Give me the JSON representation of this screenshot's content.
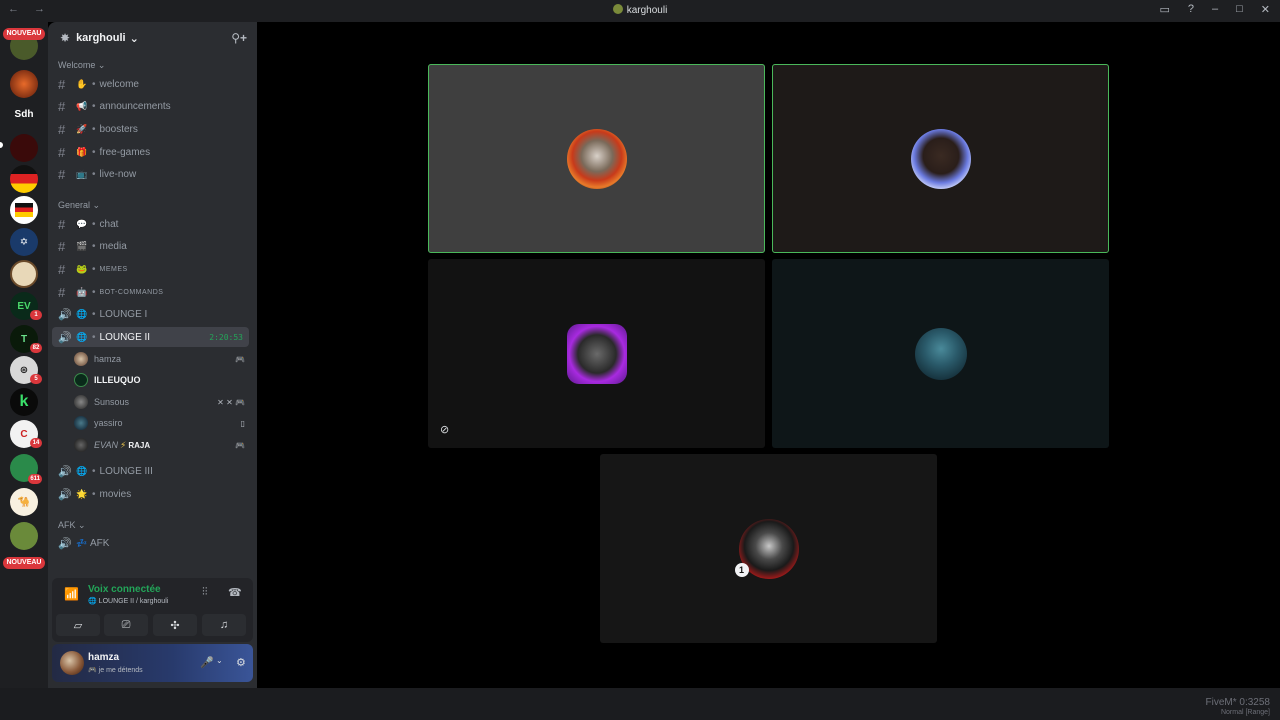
{
  "window": {
    "title": "karghouli",
    "nav": "← →"
  },
  "rail": {
    "top_badge": "NOUVEAU",
    "bottom_badge": "NOUVEAU",
    "text_server": "Sdh",
    "badges": [
      "1",
      "82",
      "5",
      "14",
      "611"
    ]
  },
  "server": {
    "name": "karghouli"
  },
  "categories": {
    "welcome": "Welcome",
    "general": "General",
    "afk": "AFK"
  },
  "channels": {
    "welcome": "welcome",
    "announcements": "announcements",
    "boosters": "boosters",
    "free_games": "free-games",
    "live_now": "live-now",
    "chat": "chat",
    "media": "media",
    "memes": "MEMES",
    "bot_commands": "BOT-COMMANDS",
    "lounge1": "LOUNGE I",
    "lounge2": "LOUNGE II",
    "lounge2_timer": "2:20:53",
    "lounge3": "LOUNGE III",
    "movies": "movies",
    "afk": "AFK"
  },
  "voice_users": [
    {
      "name": "hamza"
    },
    {
      "name": "ILLEUQUO"
    },
    {
      "name": "Sunsous"
    },
    {
      "name": "yassiro"
    },
    {
      "name_prefix": "EVAN",
      "name_suffix": "RAJA"
    }
  ],
  "voice_panel": {
    "status": "Voix connectée",
    "location": "LOUNGE II / karghouli"
  },
  "user_panel": {
    "name": "hamza",
    "status": "je me détends"
  },
  "watermark": {
    "line1": "FiveM* 0:3258",
    "line2": "Normal [Range]"
  },
  "colors": {
    "speaking": "#4ab85a",
    "connected": "#23a559",
    "badge": "#da373c"
  }
}
